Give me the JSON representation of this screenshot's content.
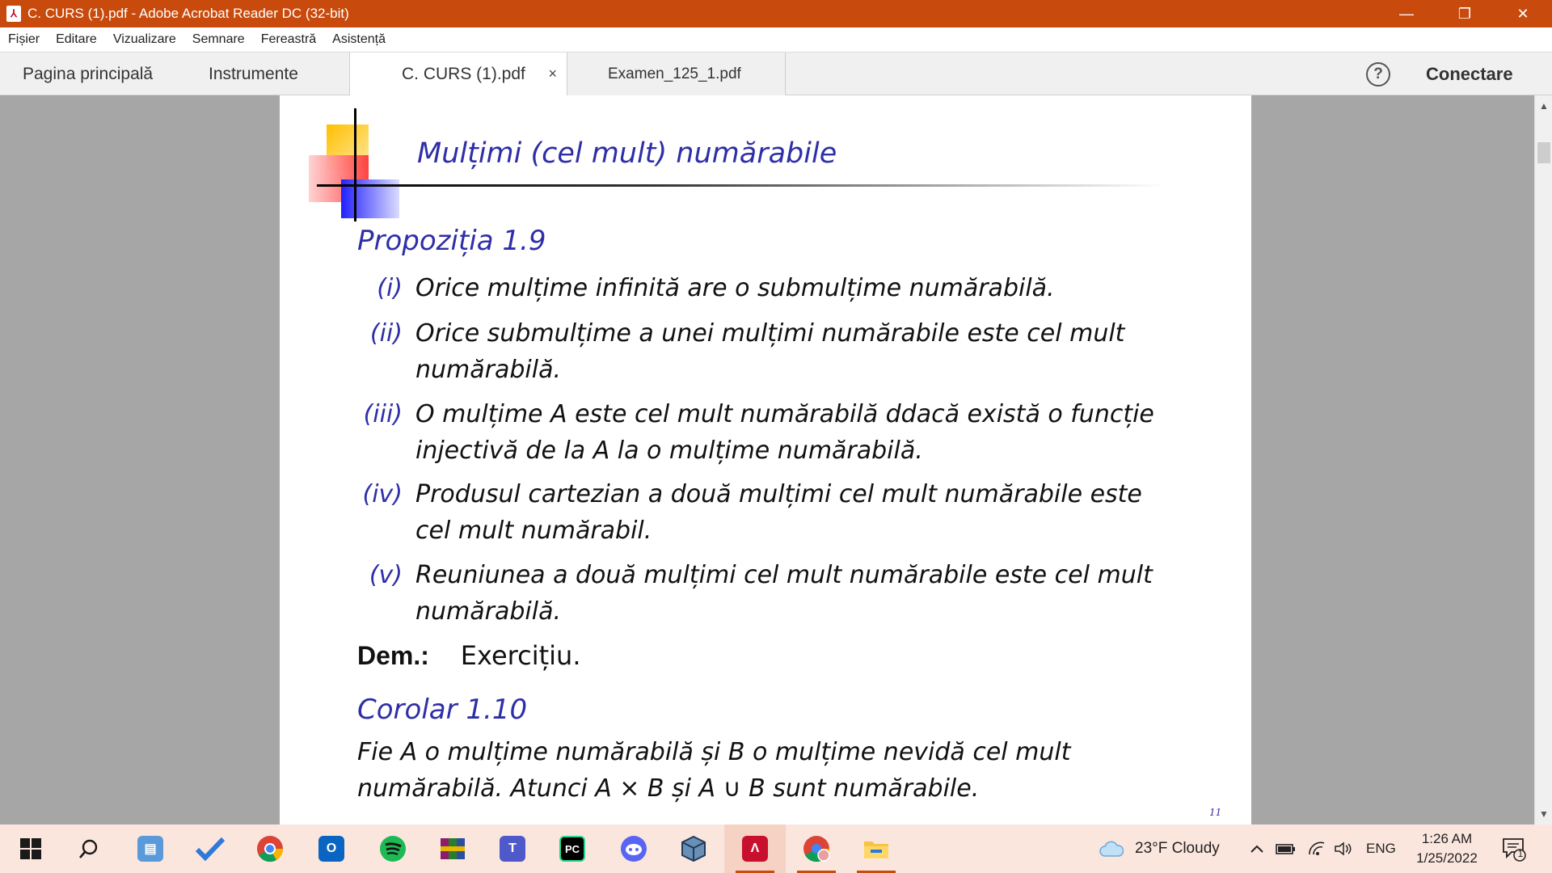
{
  "window": {
    "title": "C. CURS (1).pdf - Adobe Acrobat Reader DC (32-bit)",
    "minimize_icon": "minimize-icon",
    "restore_icon": "restore-icon",
    "close_icon": "close-icon"
  },
  "menu": [
    "Fișier",
    "Editare",
    "Vizualizare",
    "Semnare",
    "Fereastră",
    "Asistență"
  ],
  "tabs": {
    "home": "Pagina principală",
    "tools": "Instrumente",
    "doc_active": "C. CURS (1).pdf",
    "doc_other": "Examen_125_1.pdf",
    "close": "×",
    "help": "?",
    "connect": "Conectare"
  },
  "slide": {
    "title": "Mulțimi (cel mult) numărabile",
    "proposition": "Propoziția 1.9",
    "items": [
      {
        "num": "(i)",
        "text": "Orice mulțime infinită are o submulțime numărabilă."
      },
      {
        "num": "(ii)",
        "text": "Orice submulțime a unei mulțimi numărabile este cel mult numărabilă."
      },
      {
        "num": "(iii)",
        "text": "O mulțime A este cel mult numărabilă ddacă există o funcție injectivă de la A la o mulțime numărabilă."
      },
      {
        "num": "(iv)",
        "text": "Produsul cartezian a două mulțimi cel mult numărabile este cel mult numărabil."
      },
      {
        "num": "(v)",
        "text": "Reuniunea a două mulțimi cel mult numărabile este cel mult numărabilă."
      }
    ],
    "dem_label": "Dem.:",
    "dem_value": "Exercițiu.",
    "corollary": "Corolar 1.10",
    "corollary_text": "Fie A o mulțime numărabilă și B o mulțime nevidă cel mult numărabilă. Atunci A × B și A ∪ B sunt numărabile.",
    "page_number": "11"
  },
  "taskbar": {
    "apps": [
      "start-icon",
      "search-icon",
      "laptop-icon",
      "todo-icon",
      "chrome-icon",
      "outlook-icon",
      "spotify-icon",
      "winrar-icon",
      "teams-icon",
      "pycharm-icon",
      "discord-icon",
      "virtualbox-icon",
      "acrobat-icon",
      "chrome-profile-icon",
      "file-explorer-icon"
    ],
    "weather": "23°F  Cloudy",
    "language": "ENG",
    "time": "1:26 AM",
    "date": "1/25/2022",
    "notification_count": "1"
  }
}
